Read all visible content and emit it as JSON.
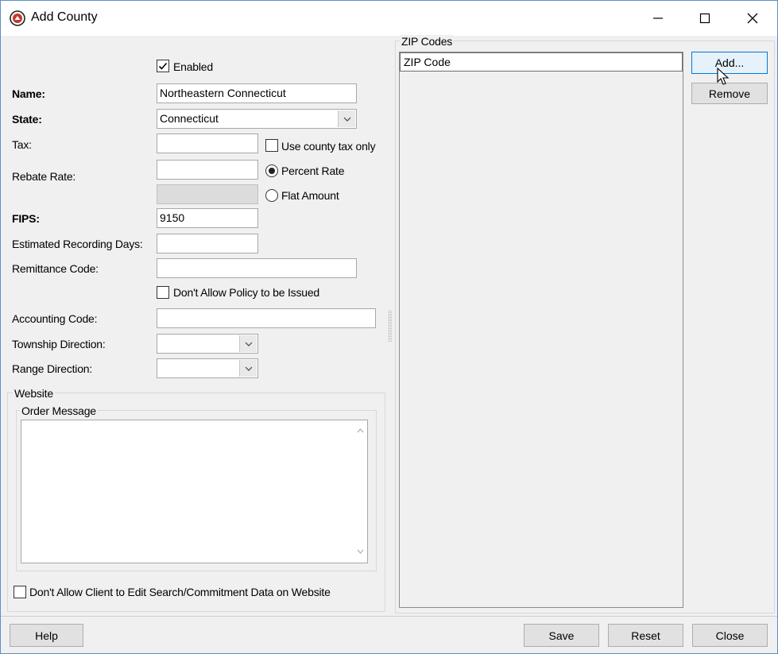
{
  "window": {
    "title": "Add County",
    "controls": {
      "minimize": "minimize",
      "maximize": "maximize",
      "close": "close"
    }
  },
  "form": {
    "enabled": {
      "label": "Enabled",
      "checked": true
    },
    "name": {
      "label": "Name:",
      "value": "Northeastern Connecticut"
    },
    "state": {
      "label": "State:",
      "value": "Connecticut"
    },
    "tax": {
      "label": "Tax:",
      "value": ""
    },
    "use_county_tax_only": {
      "label": "Use county tax only",
      "checked": false
    },
    "rebate_rate": {
      "label": "Rebate Rate:",
      "value": ""
    },
    "percent_rate": {
      "label": "Percent Rate",
      "selected": true
    },
    "flat_amount": {
      "label": "Flat Amount",
      "selected": false
    },
    "fips": {
      "label": "FIPS:",
      "value": "9150"
    },
    "estimated_recording_days": {
      "label": "Estimated Recording Days:",
      "value": ""
    },
    "remittance_code": {
      "label": "Remittance Code:",
      "value": ""
    },
    "dont_allow_policy": {
      "label": "Don't Allow Policy to be Issued",
      "checked": false
    },
    "accounting_code": {
      "label": "Accounting Code:",
      "value": ""
    },
    "township_direction": {
      "label": "Township Direction:",
      "value": ""
    },
    "range_direction": {
      "label": "Range Direction:",
      "value": ""
    }
  },
  "website": {
    "group_label": "Website",
    "order_message_label": "Order Message",
    "order_message": "",
    "dont_allow_client_edit": {
      "label": "Don't Allow Client to Edit Search/Commitment Data on Website",
      "checked": false
    }
  },
  "zip_codes": {
    "group_label": "ZIP Codes",
    "column_header": "ZIP Code",
    "items": [],
    "add_label": "Add...",
    "remove_label": "Remove"
  },
  "footer": {
    "help_label": "Help",
    "save_label": "Save",
    "reset_label": "Reset",
    "close_label": "Close"
  },
  "colors": {
    "window_border": "#5a8fc4",
    "focus_blue": "#0078d7",
    "app_icon_red": "#c0392b"
  }
}
